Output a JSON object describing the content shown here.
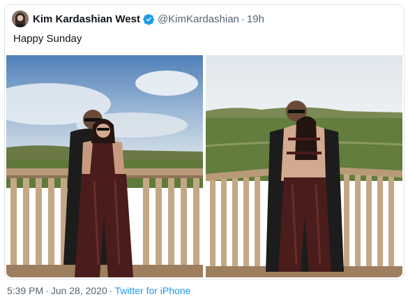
{
  "tweet": {
    "author_name": "Kim Kardashian West",
    "author_handle": "@KimKardashian",
    "separator": "·",
    "relative_time": "19h",
    "text": "Happy Sunday",
    "verified": true
  },
  "footer": {
    "time": "5:39 PM",
    "sep1": "·",
    "date": "Jun 28, 2020",
    "sep2": "·",
    "source": "Twitter for iPhone"
  },
  "colors": {
    "verified_blue": "#1d9bf0",
    "link_blue": "#1d9bf0",
    "muted_text": "#536471",
    "sky_blue": "#5f8fc4",
    "grass_green": "#5f7a3a",
    "latex_brown": "#4a1c1c"
  },
  "media": {
    "photo_count": 2,
    "left_photo": "couple-on-wooden-deck-front",
    "right_photo": "couple-on-wooden-deck-embrace"
  }
}
